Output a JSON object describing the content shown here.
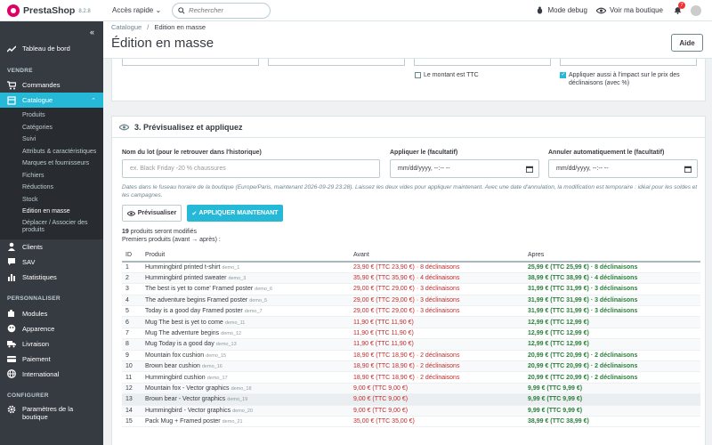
{
  "topbar": {
    "brand": "PrestaShop",
    "version": "8.2.8",
    "quick_access": "Accès rapide ⌄",
    "search_placeholder": "Rechercher",
    "debug": "Mode debug",
    "view_shop": "Voir ma boutique",
    "notif_count": "7"
  },
  "sidebar": {
    "dashboard": "Tableau de bord",
    "sections": {
      "sell": "VENDRE",
      "customize": "PERSONNALISER",
      "configure": "CONFIGURER"
    },
    "orders": "Commandes",
    "catalog": "Catalogue",
    "catalog_sub": [
      "Produits",
      "Catégories",
      "Suivi",
      "Attributs & caractéristiques",
      "Marques et fournisseurs",
      "Fichiers",
      "Réductions",
      "Stock",
      "Edition en masse"
    ],
    "catalog_sub_last": "Déplacer / Associer des produits",
    "clients": "Clients",
    "sav": "SAV",
    "stats": "Statistiques",
    "modules": "Modules",
    "appearance": "Apparence",
    "shipping": "Livraison",
    "payment": "Paiement",
    "international": "International",
    "shop_params": "Paramètres de la boutique"
  },
  "header": {
    "breadcrumb_parent": "Catalogue",
    "breadcrumb_current": "Edition en masse",
    "title": "Édition en masse",
    "help": "Aide"
  },
  "prev_section": {
    "ttc_label": "Le montant est TTC",
    "apply_decl_label": "Appliquer aussi à l'impact sur le prix des déclinaisons (avec %)"
  },
  "preview_card": {
    "title": "3. Prévisualisez et appliquez",
    "batch_label": "Nom du lot (pour le retrouver dans l'historique)",
    "batch_placeholder": "ex. Black Friday -20 % chaussures",
    "apply_label": "Appliquer le (facultatif)",
    "cancel_label": "Annuler automatiquement le (facultatif)",
    "date_placeholder": "mm/dd/yyyy, --:-- --",
    "hint": "Dates dans le fuseau horaire de la boutique (Europe/Paris, maintenant 2026-09-29 23:28). Laissez les deux vides pour appliquer maintenant. Avec une date d'annulation, la modification est temporaire : idéal pour les soldes et les campagnes.",
    "btn_preview": "Prévisualiser",
    "btn_apply": "APPLIQUER MAINTENANT",
    "summary_count": "19",
    "summary_text": " produits seront modifiés",
    "summary_sub": "Premiers produits (avant → après) :"
  },
  "table": {
    "headers": [
      "ID",
      "Produit",
      "Avant",
      "Apres"
    ],
    "rows": [
      {
        "id": "1",
        "name": "Hummingbird printed t-shirt",
        "ref": "demo_1",
        "before": "23,90 € (TTC 23,90 €) · 8 déclinaisons",
        "after": "25,99 € (TTC 25,99 €) · 8 déclinaisons"
      },
      {
        "id": "2",
        "name": "Hummingbird printed sweater",
        "ref": "demo_3",
        "before": "35,90 € (TTC 35,90 €) · 4 déclinaisons",
        "after": "38,99 € (TTC 38,99 €) · 4 déclinaisons"
      },
      {
        "id": "3",
        "name": "The best is yet to come' Framed poster",
        "ref": "demo_6",
        "before": "29,00 € (TTC 29,00 €) · 3 déclinaisons",
        "after": "31,99 € (TTC 31,99 €) · 3 déclinaisons"
      },
      {
        "id": "4",
        "name": "The adventure begins Framed poster",
        "ref": "demo_5",
        "before": "29,00 € (TTC 29,00 €) · 3 déclinaisons",
        "after": "31,99 € (TTC 31,99 €) · 3 déclinaisons"
      },
      {
        "id": "5",
        "name": "Today is a good day Framed poster",
        "ref": "demo_7",
        "before": "29,00 € (TTC 29,00 €) · 3 déclinaisons",
        "after": "31,99 € (TTC 31,99 €) · 3 déclinaisons"
      },
      {
        "id": "6",
        "name": "Mug The best is yet to come",
        "ref": "demo_11",
        "before": "11,90 € (TTC 11,90 €)",
        "after": "12,99 € (TTC 12,99 €)"
      },
      {
        "id": "7",
        "name": "Mug The adventure begins",
        "ref": "demo_12",
        "before": "11,90 € (TTC 11,90 €)",
        "after": "12,99 € (TTC 12,99 €)"
      },
      {
        "id": "8",
        "name": "Mug Today is a good day",
        "ref": "demo_13",
        "before": "11,90 € (TTC 11,90 €)",
        "after": "12,99 € (TTC 12,99 €)"
      },
      {
        "id": "9",
        "name": "Mountain fox cushion",
        "ref": "demo_15",
        "before": "18,90 € (TTC 18,90 €) · 2 déclinaisons",
        "after": "20,99 € (TTC 20,99 €) · 2 déclinaisons"
      },
      {
        "id": "10",
        "name": "Brown bear cushion",
        "ref": "demo_16",
        "before": "18,90 € (TTC 18,90 €) · 2 déclinaisons",
        "after": "20,99 € (TTC 20,99 €) · 2 déclinaisons"
      },
      {
        "id": "11",
        "name": "Hummingbird cushion",
        "ref": "demo_17",
        "before": "18,90 € (TTC 18,90 €) · 2 déclinaisons",
        "after": "20,99 € (TTC 20,99 €) · 2 déclinaisons"
      },
      {
        "id": "12",
        "name": "Mountain fox - Vector graphics",
        "ref": "demo_18",
        "before": "9,00 € (TTC 9,00 €)",
        "after": "9,99 € (TTC 9,99 €)"
      },
      {
        "id": "13",
        "name": "Brown bear - Vector graphics",
        "ref": "demo_19",
        "before": "9,00 € (TTC 9,00 €)",
        "after": "9,99 € (TTC 9,99 €)"
      },
      {
        "id": "14",
        "name": "Hummingbird - Vector graphics",
        "ref": "demo_20",
        "before": "9,00 € (TTC 9,00 €)",
        "after": "9,99 € (TTC 9,99 €)"
      },
      {
        "id": "15",
        "name": "Pack Mug + Framed poster",
        "ref": "demo_21",
        "before": "35,00 € (TTC 35,00 €)",
        "after": "38,99 € (TTC 38,99 €)"
      }
    ]
  },
  "colors": {
    "accent": "#25b9d7",
    "sidebar": "#363a41",
    "brand": "#df0067",
    "before": "#c12a2a",
    "after": "#2a7f3a"
  }
}
